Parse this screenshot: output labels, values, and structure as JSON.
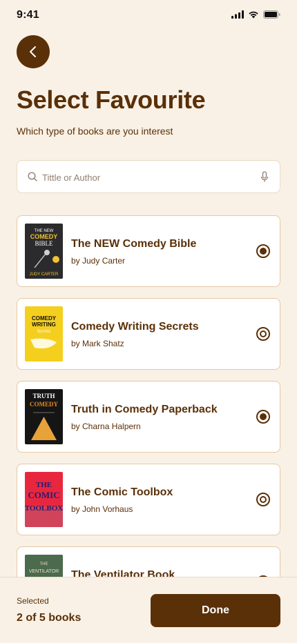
{
  "status_bar": {
    "time": "9:41",
    "icons": [
      "signal-icon",
      "wifi-icon",
      "battery-icon"
    ]
  },
  "header": {
    "back_icon": "chevron-left-icon",
    "title": "Select Favourite",
    "subtitle": "Which type of books are you interest"
  },
  "search": {
    "placeholder": "Tittle or Author",
    "value": "",
    "icons": [
      "search-icon",
      "microphone-icon"
    ]
  },
  "books": [
    {
      "title": "The NEW Comedy Bible",
      "author": "by Judy Carter",
      "selected": true,
      "cover": {
        "lines": [
          "THE NEW",
          "COMEDY",
          "BIBLE",
          "JUDY CARTER"
        ],
        "bg": "#2b2b2e",
        "accent": "#f2c230"
      }
    },
    {
      "title": "Comedy Writing Secrets",
      "author": "by Mark Shatz",
      "selected": false,
      "cover": {
        "lines": [
          "COMEDY",
          "WRITING",
          "Secrets"
        ],
        "bg": "#f5cf1d",
        "accent": "#ffffff"
      }
    },
    {
      "title": "Truth in Comedy Paperback",
      "author": "by Charna Halpern",
      "selected": true,
      "cover": {
        "lines": [
          "TRUTH",
          "COMEDY"
        ],
        "bg": "#151515",
        "accent": "#e58a1f"
      }
    },
    {
      "title": "The Comic Toolbox",
      "author": "by John Vorhaus",
      "selected": false,
      "cover": {
        "lines": [
          "THE",
          "COMIC",
          "TOOLBOX"
        ],
        "bg": "#e8273f",
        "accent": "#2a1a6b"
      }
    },
    {
      "title": "The Ventilator Book",
      "author": "",
      "selected": false,
      "cover": {
        "lines": [
          "THE",
          "VENTILATOR"
        ],
        "bg": "#4c6a4d",
        "accent": "#c86a3a"
      }
    }
  ],
  "footer": {
    "selected_label": "Selected",
    "selected_count": "2 of 5 books",
    "done_label": "Done"
  },
  "colors": {
    "primary": "#5a3008",
    "background": "#f9f1e6",
    "card_border": "#e4c8a3"
  }
}
